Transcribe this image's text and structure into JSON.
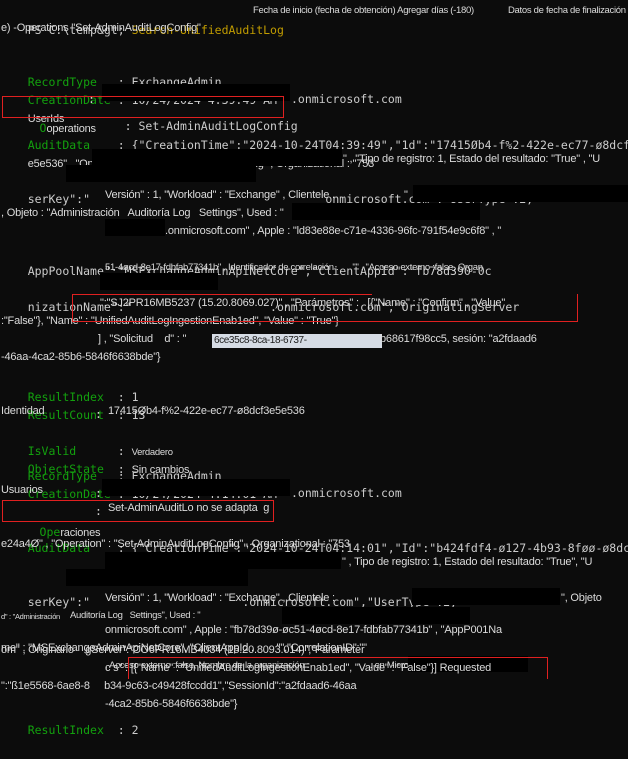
{
  "window": {
    "app": "Windows PowerShell",
    "background_color": "#0c0c0c",
    "foreground_color": "#cccccc",
    "property_color": "#13a10e",
    "command_color": "#c19c00",
    "annotation_color": "#e02020",
    "selection_background": "#d6dce5"
  },
  "prompt": {
    "path": "PS C:\\temp&gt;",
    "command": "Search-UnifiedAuditLog",
    "arg_note_1": "Fecha de inicio (fecha de obtención) Agregar días (-180)",
    "arg_note_2": "Datos de fecha de finalización",
    "continuation": "e) -Operations \"Set-AdminAuditLogConfig\""
  },
  "records": [
    {
      "index": 1,
      "fields": {
        "RecordType": {
          "label": "RecordType",
          "value": "ExchangeAdmin"
        },
        "CreationDate": {
          "label": "CreationDate",
          "value": "10/24/2024 4:39:49 AM"
        },
        "UserIds": {
          "label": "UserIds",
          "value": ".onmicrosoft.com",
          "redacted": true
        },
        "Operations": {
          "label_green": "O",
          "label_rest": "operations",
          "value": "Set-AdminAuditLogConfig",
          "boxed": true
        },
        "AuditData": {
          "label": "AuditData"
        },
        "ResultIndex": {
          "label": "ResultIndex",
          "value": "1"
        },
        "ResultCount": {
          "label": "ResultCount",
          "value": "13"
        },
        "Identity": {
          "label": "Identidad",
          "value": "17415Øb4-f%2-422e-ec77-ø8dcf3e5e536"
        },
        "IsValid": {
          "label": "IsValid",
          "value": "Verdadero"
        },
        "ObjectState": {
          "label": "ObjectState",
          "value": "Sin cambios"
        }
      },
      "audit_lines": [
        "{\"CreationTime\":\"2024-10-24T04:39:49\",\"1d\":\"17415Øb4-f%2-422e-ec77-ø8dcf3",
        "e5e536\" , \"Operation\" : \"Set-AdminAuditLogConfig\" , Organizational : \"753",
        "\" , \"Tipo de registro: 1, Estado del resultado: \"True\" , \"U",
        "serKey\":\"                                  onmicrosoft.com\",\"UserType\":2,\"",
        "Versión\" : 1, \"Workload\" : \"Exchange\" , Clientele .",
        ", Objeto : \"Administración   Auditoría Log   Settings\", Used : \"",
        ".onmicrosoft.com\" , Apple : \"ld83e88e-c71e-4336-96fc-791f54e9c6f8\" , \"",
        "AppPoolName\":\"MSExchangeAdminApiNetCore\",\"ClientAppId\":\"fb78d390-0c",
        "51-4øcd-8e17-fdbfab77341b\" , Identificador de correlación .      \"\" , \"Acceso externo :false, Organ",
        "nizationName\":\"                    .onmicrosoft.com\",\"OriginatingServer",
        "\":\"SJ2PR16MB5237 (15.20.8069.027)\" , \"Parámetros\" :   [{\"Name\" : \"Confirm\" , \"Value\"",
        ":\"False\"}, \"Name\" : \"UnifiedAuditLogIngestionEnab1ed\", \"Value\" : \"True\"}",
        "] , \"Solicitud    d\" : \"",
        "-46aa-4ca2-85b6-5846f6638bde\"}"
      ],
      "selection_text": "6ce35c8-8ca-18-6737-",
      "after_selection": "b68617f98cc5, sesión: \"a2fdaad6"
    },
    {
      "index": 2,
      "fields": {
        "RecordType": {
          "label": "RecordType",
          "value": "ExchangeAdmin"
        },
        "CreationDate": {
          "label": "CreationDate",
          "value": "10/24/2024 4:14:01 AM"
        },
        "UserIds": {
          "label": "Usuarios",
          "value": ".onmicrosoft.com",
          "redacted": true
        },
        "Operations": {
          "label_green": "Ope",
          "label_rest": "raciones",
          "value": "Set-AdminAuditLo no se adapta  g",
          "boxed": true
        },
        "AuditData": {
          "label": "AuditData"
        },
        "ResultIndex": {
          "label": "ResultIndex",
          "value": "2"
        }
      },
      "audit_lines": [
        "{\"CreationTime\":\"2024-10-24T04:14:01\",\"Id\":\"b424fdf4-ø127-4b93-8føø-ø8dcf3",
        "e24a4Ø\" , \"Operation\" : \"Set-AdminAuditLogConfig\" , Organizational : \"753",
        "\" , Tipo de registro: 1, Estado del resultado: \"True\", \"U",
        "serKey\":\"                      .onmicrosoft.com\",\"UserType\":2,\"",
        "Versión\" : 1, \"Workload\" : \"Exchange\" , Clientele :",
        "\", Objeto",
        "d\" : \"Administración   Auditoría Log   Settings\", Used : \"",
        "onmicrosoft.com\" , Apple : \"fb78d39ø-øc51-4øcd-8e17-fdbfab77341b\" , \"AppP001Na",
        "me\" : \"MSExchangeAdminApiNetCore\", \"ClientAppId .        \"\",\"CorrelationID\":\"\"",
        ", Acceso externo :false, Nombre de la organización :                          . en Microsoft",
        "om\" , Originario    gServer\":\"CO6PR16MB4034 (15.20.8093.014)\",\"Parameter",
        "c s\" : [{\"Name\" : \"UnifiedAuditLogIngestionEnab1ed\", \"Value\" : \"False\"}] Requested",
        "\":\"ß1e5568-6ae8-8     b34-9c63-c49428fccdd1\",\"SessionId\":\"a2fdaad6-46aa",
        "-4ca2-85b6-5846f6638bde\"}"
      ]
    }
  ],
  "annotations": [
    {
      "name": "operations-box-record-1",
      "note": "red rectangle around Operations row of record 1"
    },
    {
      "name": "parameters-box-record-1",
      "note": "red rectangle around Parámetros UnifiedAuditLogIngestionEnab1ed True"
    },
    {
      "name": "operations-box-record-2",
      "note": "red rectangle around Operaciones row of record 2"
    },
    {
      "name": "parameters-box-record-2",
      "note": "red rectangle around Parameters UnifiedAuditLogIngestionEnab1ed False"
    }
  ]
}
